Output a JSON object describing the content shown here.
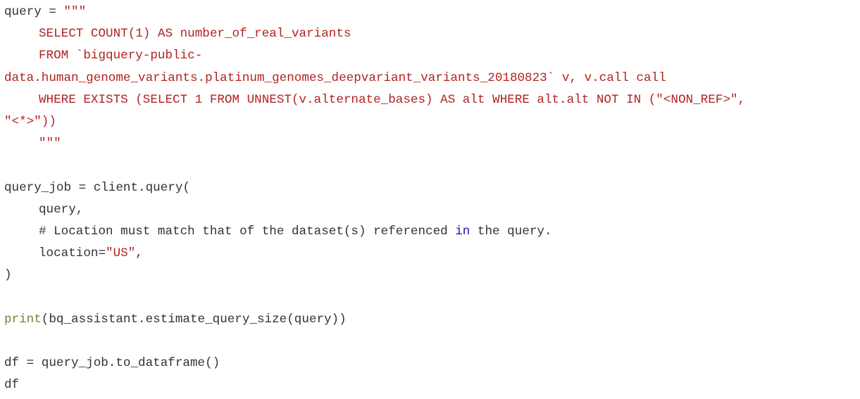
{
  "colors": {
    "default_text": "#333333",
    "string": "#b22222",
    "keyword": "#1a1aa6",
    "builtin": "#7f7f3f",
    "background": "#ffffff"
  },
  "code": {
    "l1_var": "query = ",
    "l1_str": "\"\"\"",
    "l2": "SELECT COUNT(1) AS number_of_real_variants",
    "l3": "FROM `bigquery-public-",
    "l4": "data.human_genome_variants.platinum_genomes_deepvariant_variants_20180823` v, v.call call",
    "l5": "WHERE EXISTS (SELECT 1 FROM UNNEST(v.alternate_bases) AS alt WHERE alt.alt NOT IN (\"<NON_REF>\",",
    "l6": "\"<*>\"))",
    "l7": "\"\"\"",
    "l9": "query_job = client.query(",
    "l10": "query,",
    "l11_a": "# Location must match that of the dataset(s) referenced ",
    "l11_kw": "in",
    "l11_b": " the query.",
    "l12_a": "location=",
    "l12_str": "\"US\"",
    "l12_b": ",",
    "l13": ")",
    "l15_fn": "print",
    "l15_rest": "(bq_assistant.estimate_query_size(query))",
    "l17": "df = query_job.to_dataframe()",
    "l18": "df"
  }
}
